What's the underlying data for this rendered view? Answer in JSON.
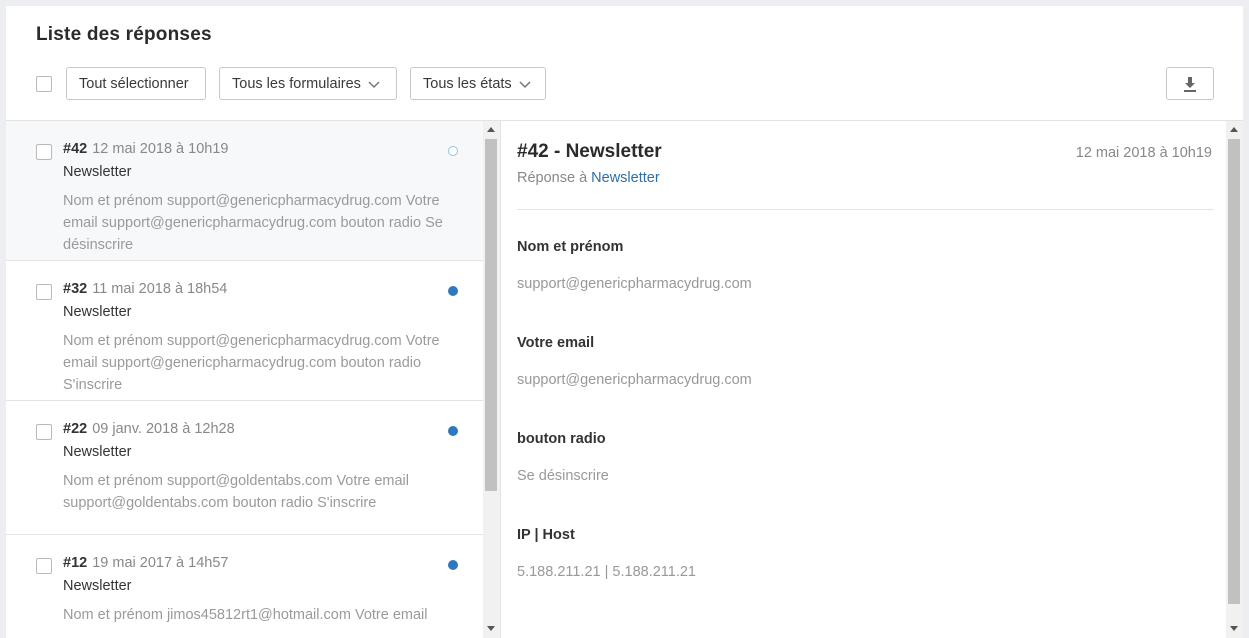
{
  "header": {
    "title": "Liste des réponses"
  },
  "toolbar": {
    "select_all_label": "Tout sélectionner",
    "forms_label": "Tous les formulaires",
    "states_label": "Tous les états"
  },
  "responses": [
    {
      "num": "#42",
      "date": "12 mai 2018 à 10h19",
      "form": "Newsletter",
      "preview": "Nom et prénom support@genericpharmacydrug.com Votre email support@genericpharmacydrug.com bouton radio Se désinscrire",
      "read": true
    },
    {
      "num": "#32",
      "date": "11 mai 2018 à 18h54",
      "form": "Newsletter",
      "preview": "Nom et prénom support@genericpharmacydrug.com Votre email support@genericpharmacydrug.com bouton radio S'inscrire",
      "read": false
    },
    {
      "num": "#22",
      "date": "09 janv. 2018 à 12h28",
      "form": "Newsletter",
      "preview": "Nom et prénom support@goldentabs.com Votre email support@goldentabs.com bouton radio S'inscrire",
      "read": false
    },
    {
      "num": "#12",
      "date": "19 mai 2017 à 14h57",
      "form": "Newsletter",
      "preview": "Nom et prénom jimos45812rt1@hotmail.com Votre email",
      "read": false
    }
  ],
  "detail": {
    "title": "#42 - Newsletter",
    "date": "12 mai 2018 à 10h19",
    "sub_prefix": "Réponse à",
    "sub_link": "Newsletter",
    "fields": [
      {
        "label": "Nom et prénom",
        "value": "support@genericpharmacydrug.com"
      },
      {
        "label": "Votre email",
        "value": "support@genericpharmacydrug.com"
      },
      {
        "label": "bouton radio",
        "value": "Se désinscrire"
      },
      {
        "label": "IP | Host",
        "value": "5.188.211.21 | 5.188.211.21"
      }
    ]
  },
  "colors": {
    "accent": "#2e79bd",
    "link": "#2e6fa8"
  }
}
